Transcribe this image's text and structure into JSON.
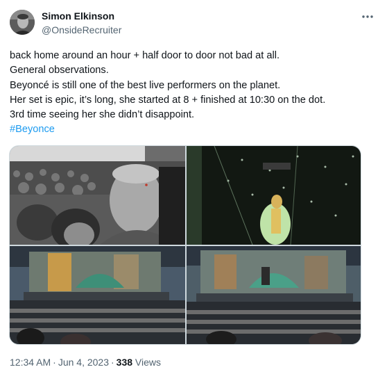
{
  "author": {
    "display_name": "Simon Elkinson",
    "handle": "@OnsideRecruiter",
    "avatar_icon": "profile-photo"
  },
  "more_icon": "more-horizontal-icon",
  "tweet": {
    "lines": [
      "back home around an hour + half door to door not bad at all.",
      "General observations.",
      "Beyoncé is still one of the best live performers on the planet.",
      "Her set is epic, it’s long, she started at 8 + finished at 10:30 on the dot.",
      "3rd time seeing her she didn’t disappoint."
    ],
    "hashtag": "#Beyonce"
  },
  "media": {
    "photos": [
      {
        "description_icon": "selfie-crowd-photo"
      },
      {
        "description_icon": "performer-stage-photo"
      },
      {
        "description_icon": "stadium-stage-photo"
      },
      {
        "description_icon": "stadium-stage-photo"
      }
    ]
  },
  "meta": {
    "time": "12:34 AM",
    "separator": "·",
    "date": "Jun 4, 2023",
    "views_count": "338",
    "views_label": "Views"
  }
}
